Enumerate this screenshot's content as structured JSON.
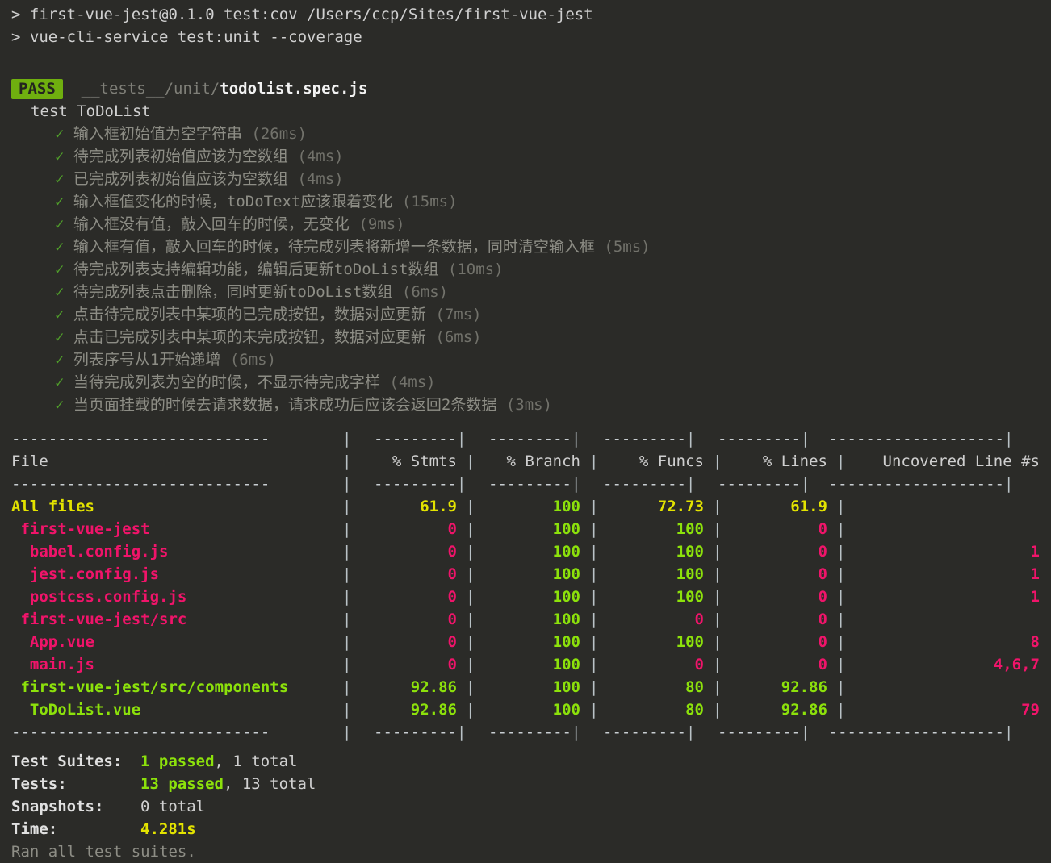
{
  "terminal": {
    "background": "#2b2b28",
    "foreground": "#d0d0d0",
    "prompt_lines": [
      "> first-vue-jest@0.1.0 test:cov /Users/ccp/Sites/first-vue-jest",
      "> vue-cli-service test:unit --coverage"
    ]
  },
  "suite": {
    "status_badge": "PASS",
    "badge_color": "#6faf0f",
    "path_prefix": "__tests__/unit/",
    "file_name": "todolist.spec.js",
    "describe_label": "test ToDoList",
    "check_glyph": "✓",
    "tests": [
      {
        "name": "输入框初始值为空字符串",
        "duration": "(26ms)"
      },
      {
        "name": "待完成列表初始值应该为空数组",
        "duration": "(4ms)"
      },
      {
        "name": "已完成列表初始值应该为空数组",
        "duration": "(4ms)"
      },
      {
        "name": "输入框值变化的时候，toDoText应该跟着变化",
        "duration": "(15ms)"
      },
      {
        "name": "输入框没有值，敲入回车的时候，无变化",
        "duration": "(9ms)"
      },
      {
        "name": "输入框有值，敲入回车的时候，待完成列表将新增一条数据，同时清空输入框",
        "duration": "(5ms)"
      },
      {
        "name": "待完成列表支持编辑功能，编辑后更新toDoList数组",
        "duration": "(10ms)"
      },
      {
        "name": "待完成列表点击删除，同时更新toDoList数组",
        "duration": "(6ms)"
      },
      {
        "name": "点击待完成列表中某项的已完成按钮，数据对应更新",
        "duration": "(7ms)"
      },
      {
        "name": "点击已完成列表中某项的未完成按钮，数据对应更新",
        "duration": "(6ms)"
      },
      {
        "name": "列表序号从1开始递增",
        "duration": "(6ms)"
      },
      {
        "name": "当待完成列表为空的时候，不显示待完成字样",
        "duration": "(4ms)"
      },
      {
        "name": "当页面挂载的时候去请求数据，请求成功后应该会返回2条数据",
        "duration": "(3ms)"
      }
    ]
  },
  "coverage": {
    "columns": [
      "File",
      "% Stmts",
      "% Branch",
      "% Funcs",
      "% Lines",
      "Uncovered Line #s"
    ],
    "separator_file": "----------------------------",
    "separator_num": "---------",
    "separator_unc": "-------------------",
    "rows": [
      {
        "file": "All files",
        "indent": 0,
        "color": "yellow",
        "stmts": "61.9",
        "stmts_color": "yellow",
        "branch": "100",
        "branch_color": "lime",
        "funcs": "72.73",
        "funcs_color": "yellow",
        "lines": "61.9",
        "lines_color": "yellow",
        "uncovered": ""
      },
      {
        "file": "first-vue-jest",
        "indent": 1,
        "color": "pink",
        "stmts": "0",
        "stmts_color": "pink",
        "branch": "100",
        "branch_color": "lime",
        "funcs": "100",
        "funcs_color": "lime",
        "lines": "0",
        "lines_color": "pink",
        "uncovered": ""
      },
      {
        "file": "babel.config.js",
        "indent": 2,
        "color": "pink",
        "stmts": "0",
        "stmts_color": "pink",
        "branch": "100",
        "branch_color": "lime",
        "funcs": "100",
        "funcs_color": "lime",
        "lines": "0",
        "lines_color": "pink",
        "uncovered": "1"
      },
      {
        "file": "jest.config.js",
        "indent": 2,
        "color": "pink",
        "stmts": "0",
        "stmts_color": "pink",
        "branch": "100",
        "branch_color": "lime",
        "funcs": "100",
        "funcs_color": "lime",
        "lines": "0",
        "lines_color": "pink",
        "uncovered": "1"
      },
      {
        "file": "postcss.config.js",
        "indent": 2,
        "color": "pink",
        "stmts": "0",
        "stmts_color": "pink",
        "branch": "100",
        "branch_color": "lime",
        "funcs": "100",
        "funcs_color": "lime",
        "lines": "0",
        "lines_color": "pink",
        "uncovered": "1"
      },
      {
        "file": "first-vue-jest/src",
        "indent": 1,
        "color": "pink",
        "stmts": "0",
        "stmts_color": "pink",
        "branch": "100",
        "branch_color": "lime",
        "funcs": "0",
        "funcs_color": "pink",
        "lines": "0",
        "lines_color": "pink",
        "uncovered": ""
      },
      {
        "file": "App.vue",
        "indent": 2,
        "color": "pink",
        "stmts": "0",
        "stmts_color": "pink",
        "branch": "100",
        "branch_color": "lime",
        "funcs": "100",
        "funcs_color": "lime",
        "lines": "0",
        "lines_color": "pink",
        "uncovered": "8"
      },
      {
        "file": "main.js",
        "indent": 2,
        "color": "pink",
        "stmts": "0",
        "stmts_color": "pink",
        "branch": "100",
        "branch_color": "lime",
        "funcs": "0",
        "funcs_color": "pink",
        "lines": "0",
        "lines_color": "pink",
        "uncovered": "4,6,7"
      },
      {
        "file": "first-vue-jest/src/components",
        "indent": 1,
        "color": "lime",
        "stmts": "92.86",
        "stmts_color": "lime",
        "branch": "100",
        "branch_color": "lime",
        "funcs": "80",
        "funcs_color": "lime",
        "lines": "92.86",
        "lines_color": "lime",
        "uncovered": ""
      },
      {
        "file": "ToDoList.vue",
        "indent": 2,
        "color": "lime",
        "stmts": "92.86",
        "stmts_color": "lime",
        "branch": "100",
        "branch_color": "lime",
        "funcs": "80",
        "funcs_color": "lime",
        "lines": "92.86",
        "lines_color": "lime",
        "uncovered": "79"
      }
    ]
  },
  "summary": {
    "test_suites": {
      "label": "Test Suites:",
      "passed": "1 passed",
      "total": ", 1 total"
    },
    "tests": {
      "label": "Tests:",
      "passed": "13 passed",
      "total": ", 13 total"
    },
    "snapshots": {
      "label": "Snapshots:",
      "value": "0 total"
    },
    "time": {
      "label": "Time:",
      "value": "4.281s"
    },
    "footer": "Ran all test suites."
  }
}
